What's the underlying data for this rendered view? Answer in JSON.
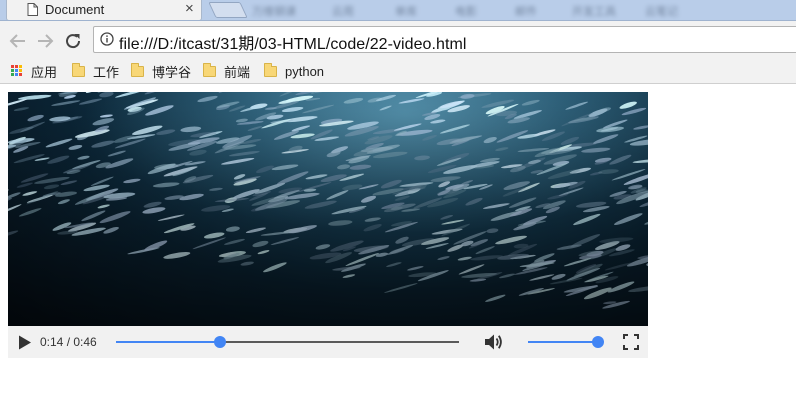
{
  "browser": {
    "tab": {
      "title": "Document",
      "close_glyph": "×",
      "icon": "page-icon"
    },
    "other_tabs": [
      "万维钢课",
      "云周",
      "单库",
      "电影",
      "邮件",
      "开发工具",
      "云笔记"
    ],
    "toolbar": {
      "back_icon": "back-arrow-icon",
      "forward_icon": "forward-arrow-icon",
      "reload_icon": "reload-icon",
      "info_icon": "info-icon",
      "url": "file:///D:/itcast/31期/03-HTML/code/22-video.html"
    },
    "bookmarks": [
      {
        "label": "应用",
        "icon": "apps-grid-icon"
      },
      {
        "label": "工作",
        "icon": "folder-icon"
      },
      {
        "label": "博学谷",
        "icon": "folder-icon"
      },
      {
        "label": "前端",
        "icon": "folder-icon"
      },
      {
        "label": "python",
        "icon": "folder-icon"
      }
    ]
  },
  "video": {
    "content": "school of fish underwater",
    "current_time": "0:14",
    "duration": "0:46",
    "time_display": "0:14 / 0:46",
    "progress_fraction": 0.3043,
    "volume_fraction": 1.0,
    "accent_color": "#4285f4",
    "icons": {
      "play": "play-icon",
      "volume": "volume-icon",
      "fullscreen": "fullscreen-icon"
    }
  }
}
